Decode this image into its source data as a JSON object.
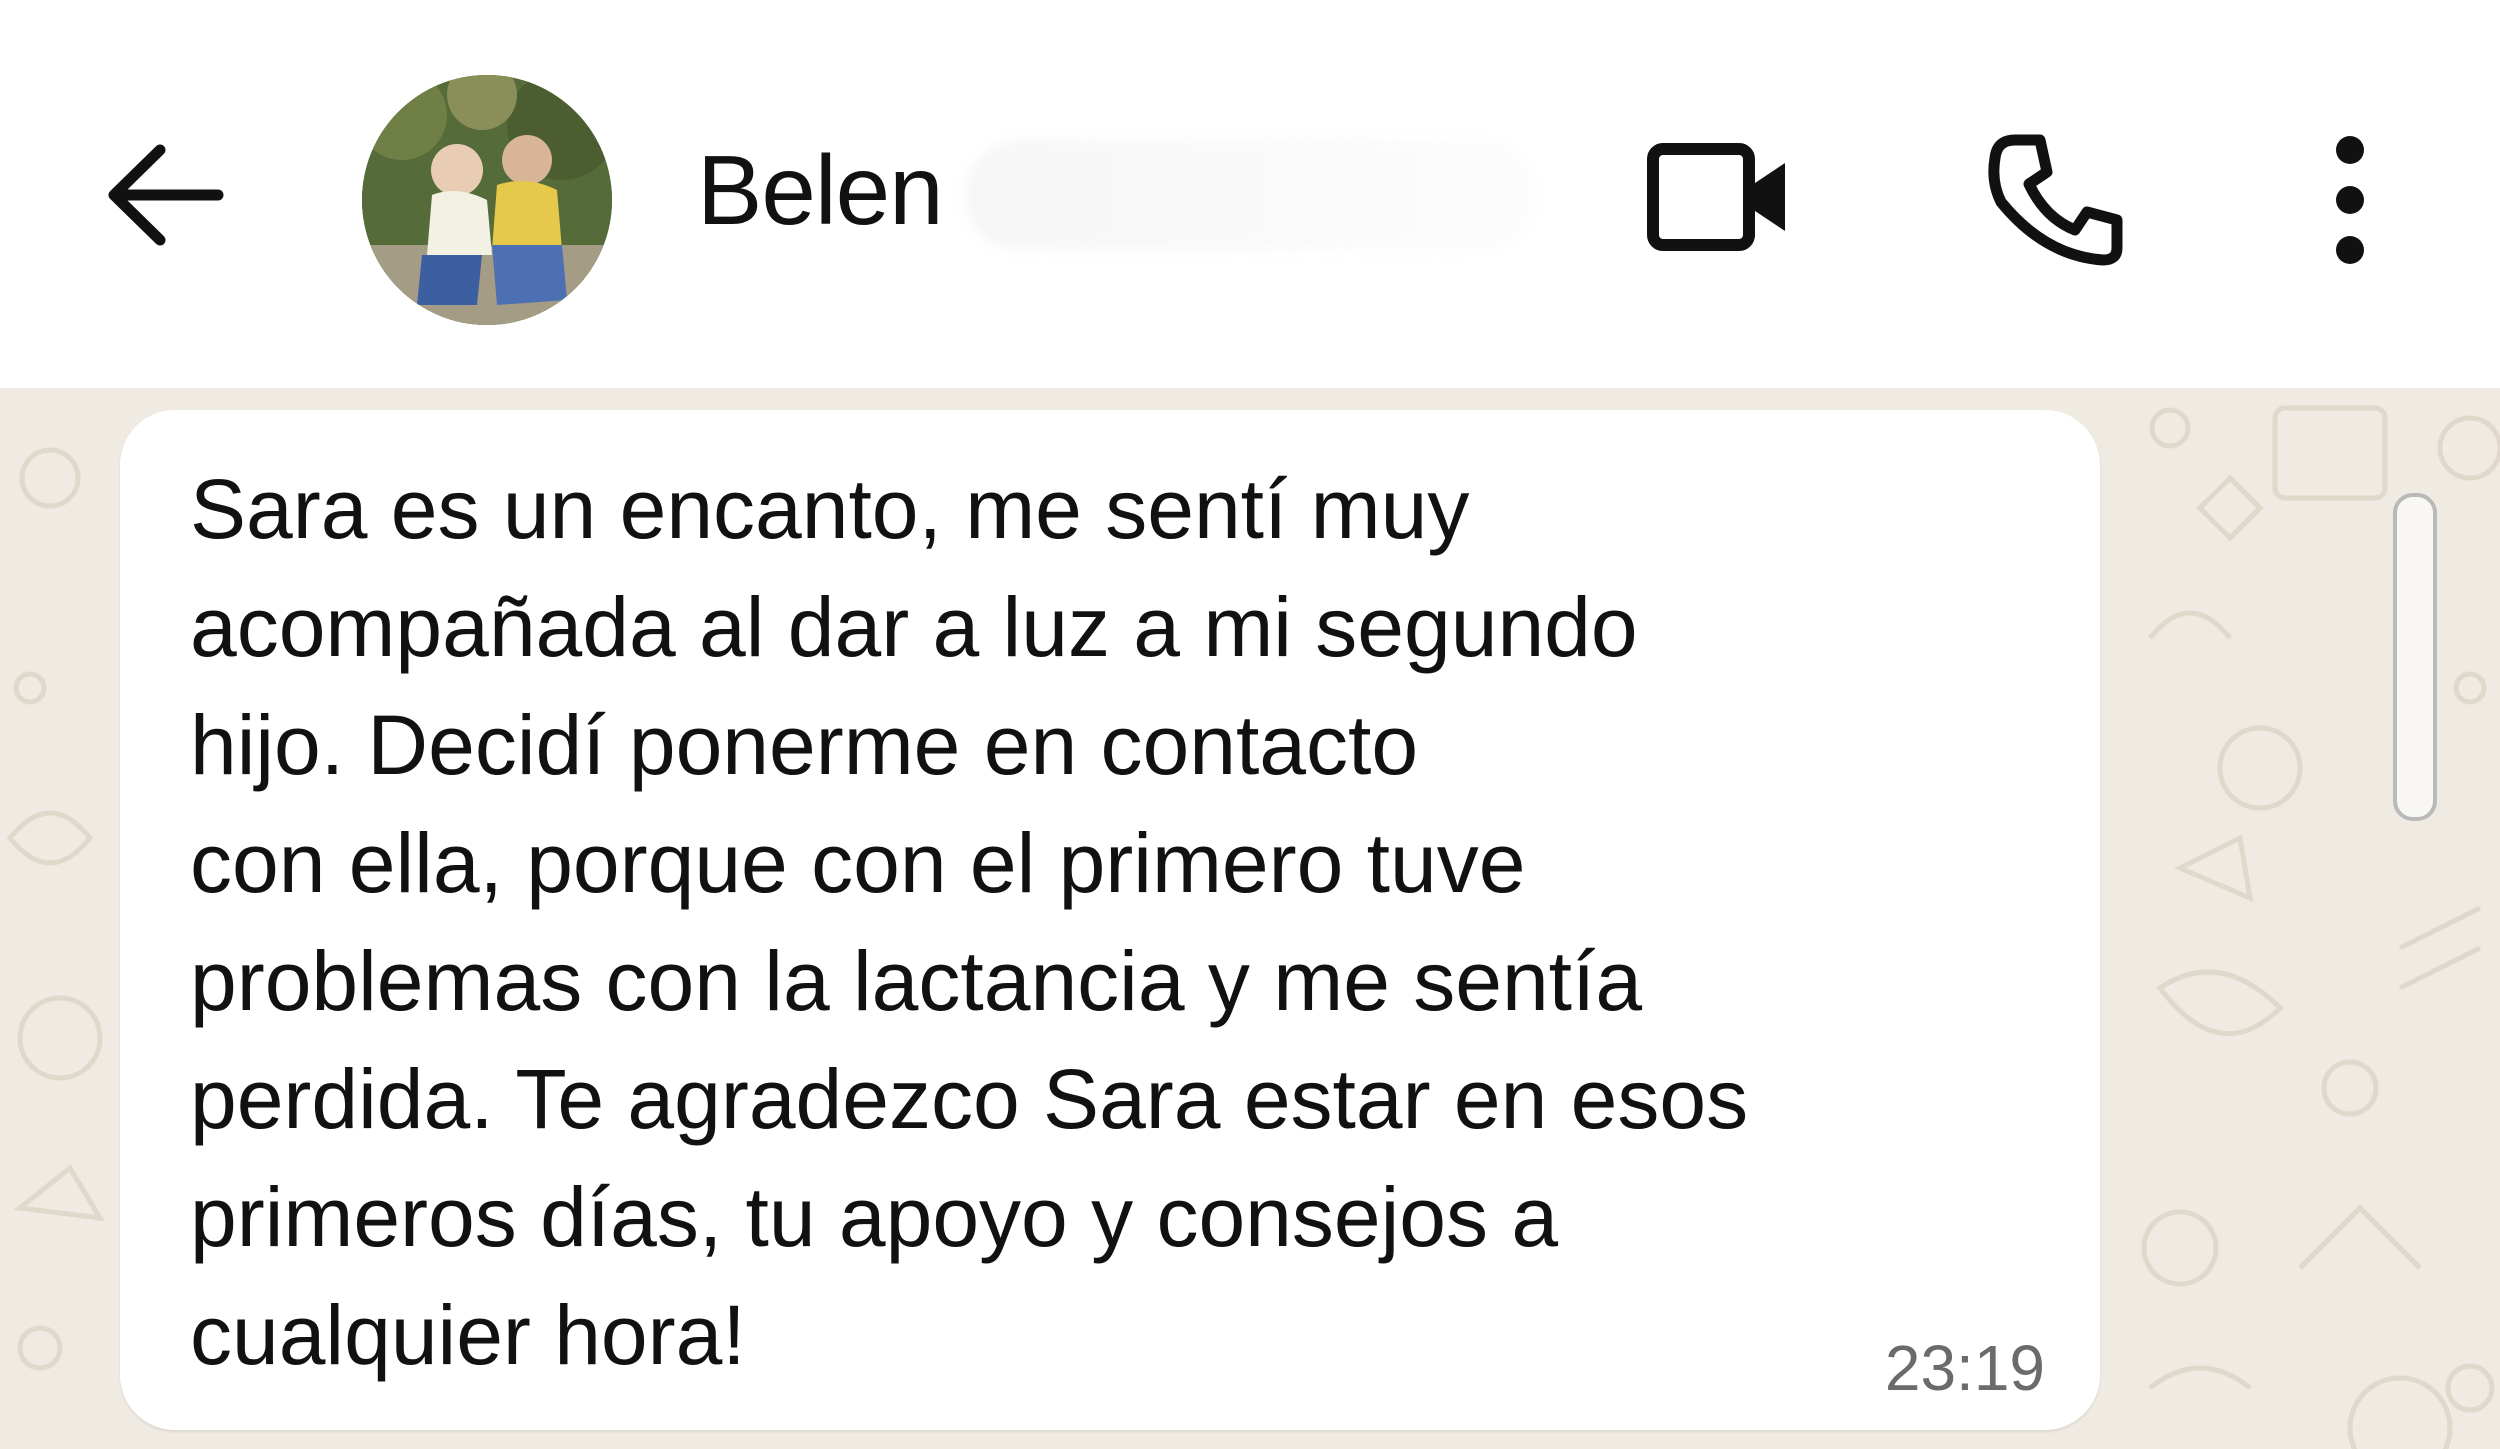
{
  "header": {
    "contact_name": "Belen",
    "icons": {
      "back": "back-arrow-icon",
      "video": "video-camera-icon",
      "call": "phone-icon",
      "menu": "more-vertical-icon"
    }
  },
  "message": {
    "text": "Sara es un encanto, me sentí muy\nacompañada al dar a luz a mi segundo\nhijo. Decidí ponerme en contacto\ncon ella, porque con el primero tuve\nproblemas con la lactancia y me sentía\nperdida. Te agradezco Sara estar en esos\nprimeros días, tu apoyo y consejos a\ncualquier hora!",
    "time": "23:19"
  },
  "colors": {
    "header_bg": "#ffffff",
    "chat_bg": "#efeae2",
    "bubble_bg": "#ffffff",
    "text": "#111111",
    "timestamp": "#6b6b6b"
  }
}
